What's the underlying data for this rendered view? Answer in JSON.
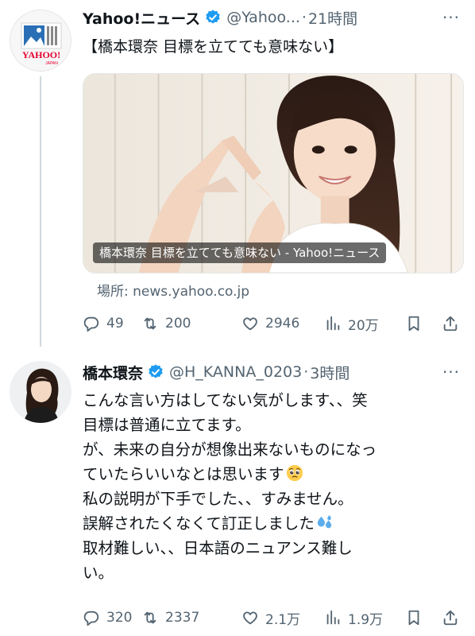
{
  "tweets": [
    {
      "author": "Yahoo!ニュース",
      "handle": "@Yahoo...",
      "separator": "·",
      "time": "21時間",
      "avatar_logo_text": "YAHOO!",
      "avatar_logo_sub": "JAPAN",
      "title": "【橋本環奈 目標を立てても意味ない】",
      "card_caption": "橋本環奈 目標を立てても意味ない - Yahoo!ニュース",
      "source": "場所: news.yahoo.co.jp",
      "replies": "49",
      "retweets": "200",
      "likes": "2946",
      "views": "20万"
    },
    {
      "author": "橋本環奈",
      "handle": "@H_KANNA_0203",
      "separator": "·",
      "time": "3時間",
      "lines": [
        "こんな言い方はしてない気がします、、笑",
        "目標は普通に立てます。",
        "が、未来の自分が想像出来ないものになっ",
        "ていたらいいなとは思います",
        "私の説明が下手でした、、すみません。",
        "誤解されたくなくて訂正しました",
        "取材難しい、、日本語のニュアンス難し",
        "い。"
      ],
      "replies": "320",
      "retweets": "2337",
      "likes": "2.1万",
      "views": "1.9万"
    }
  ],
  "icons": {
    "verified_color": "#1d9bf0",
    "action_color": "#536471",
    "more": "···"
  }
}
